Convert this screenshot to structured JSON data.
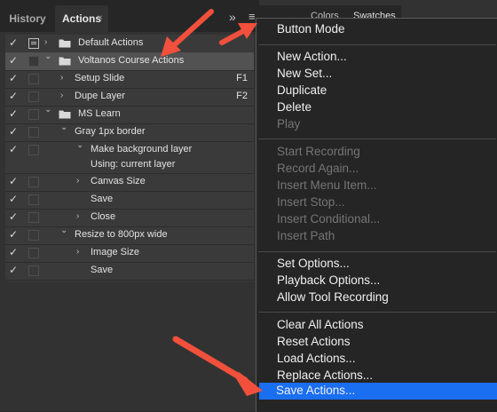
{
  "tabs": {
    "history": "History",
    "actions": "Actions",
    "close": "×",
    "collapse": "»",
    "menu": "≡"
  },
  "background_panel": {
    "tab1": "Colors",
    "tab2": "Swatches"
  },
  "actions": [
    {
      "check": "✓",
      "dialog": true,
      "chevron": "›",
      "folder": true,
      "label": "Default Actions",
      "key": ""
    },
    {
      "check": "✓",
      "dialog": false,
      "chevron": "⌄",
      "folder": true,
      "label": "Voltanos Course Actions",
      "key": "",
      "selected": true
    },
    {
      "check": "✓",
      "dialog": false,
      "chevron": "›",
      "folder": false,
      "label": "Setup Slide",
      "key": "F1"
    },
    {
      "check": "✓",
      "dialog": false,
      "chevron": "›",
      "folder": false,
      "label": "Dupe Layer",
      "key": "F2"
    },
    {
      "check": "✓",
      "dialog": false,
      "chevron": "⌄",
      "folder": true,
      "label": "MS Learn",
      "key": ""
    },
    {
      "check": "✓",
      "dialog": false,
      "chevron": "⌄",
      "folder": false,
      "label": "Gray 1px border",
      "key": ""
    },
    {
      "check": "✓",
      "dialog": false,
      "chevron": "⌄",
      "folder": false,
      "label": "Make background layer",
      "key": "",
      "sub": "Using: current layer"
    },
    {
      "check": "✓",
      "dialog": false,
      "chevron": "›",
      "folder": false,
      "label": "Canvas Size",
      "key": ""
    },
    {
      "check": "✓",
      "dialog": false,
      "chevron": "",
      "folder": false,
      "label": "Save",
      "key": ""
    },
    {
      "check": "✓",
      "dialog": false,
      "chevron": "›",
      "folder": false,
      "label": "Close",
      "key": ""
    },
    {
      "check": "✓",
      "dialog": false,
      "chevron": "⌄",
      "folder": false,
      "label": "Resize to 800px wide",
      "key": ""
    },
    {
      "check": "✓",
      "dialog": false,
      "chevron": "›",
      "folder": false,
      "label": "Image Size",
      "key": ""
    },
    {
      "check": "✓",
      "dialog": false,
      "chevron": "",
      "folder": false,
      "label": "Save",
      "key": ""
    }
  ],
  "menu": {
    "button_mode": "Button Mode",
    "new_action": "New Action...",
    "new_set": "New Set...",
    "duplicate": "Duplicate",
    "delete": "Delete",
    "play": "Play",
    "start_recording": "Start Recording",
    "record_again": "Record Again...",
    "insert_menu_item": "Insert Menu Item...",
    "insert_stop": "Insert Stop...",
    "insert_conditional": "Insert Conditional...",
    "insert_path": "Insert Path",
    "set_options": "Set Options...",
    "playback_options": "Playback Options...",
    "allow_tool_recording": "Allow Tool Recording",
    "clear_all_actions": "Clear All Actions",
    "reset_actions": "Reset Actions",
    "load_actions": "Load Actions...",
    "replace_actions": "Replace Actions...",
    "save_actions": "Save Actions..."
  },
  "colors": {
    "highlight": "#1a6ef0",
    "arrow": "#f0503c",
    "panel": "#323232",
    "menu": "#252525"
  }
}
